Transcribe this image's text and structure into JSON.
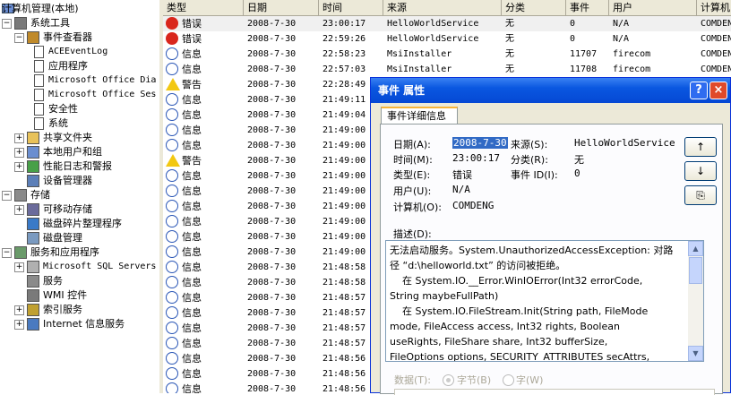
{
  "tree": {
    "root": "计算机管理(本地)",
    "items": [
      {
        "label": "系统工具",
        "level": 0,
        "exp": "−",
        "icon": "tools-icon",
        "mono": false
      },
      {
        "label": "事件查看器",
        "level": 1,
        "exp": "−",
        "icon": "event-viewer-icon",
        "mono": false
      },
      {
        "label": "ACEEventLog",
        "level": 2,
        "exp": "",
        "icon": "log-icon",
        "mono": true
      },
      {
        "label": "应用程序",
        "level": 2,
        "exp": "",
        "icon": "log-icon",
        "mono": false
      },
      {
        "label": "Microsoft Office Dia",
        "level": 2,
        "exp": "",
        "icon": "log-icon",
        "mono": true
      },
      {
        "label": "Microsoft Office Ses",
        "level": 2,
        "exp": "",
        "icon": "log-icon",
        "mono": true
      },
      {
        "label": "安全性",
        "level": 2,
        "exp": "",
        "icon": "log-icon",
        "mono": false
      },
      {
        "label": "系统",
        "level": 2,
        "exp": "",
        "icon": "log-icon",
        "mono": false
      },
      {
        "label": "共享文件夹",
        "level": 1,
        "exp": "+",
        "icon": "folder-icon",
        "mono": false
      },
      {
        "label": "本地用户和组",
        "level": 1,
        "exp": "+",
        "icon": "users-icon",
        "mono": false
      },
      {
        "label": "性能日志和警报",
        "level": 1,
        "exp": "+",
        "icon": "perf-icon",
        "mono": false
      },
      {
        "label": "设备管理器",
        "level": 1,
        "exp": "",
        "icon": "device-icon",
        "mono": false
      },
      {
        "label": "存储",
        "level": 0,
        "exp": "−",
        "icon": "storage-icon",
        "mono": false
      },
      {
        "label": "可移动存储",
        "level": 1,
        "exp": "+",
        "icon": "removable-icon",
        "mono": false
      },
      {
        "label": "磁盘碎片整理程序",
        "level": 1,
        "exp": "",
        "icon": "defrag-icon",
        "mono": false
      },
      {
        "label": "磁盘管理",
        "level": 1,
        "exp": "",
        "icon": "disk-icon",
        "mono": false
      },
      {
        "label": "服务和应用程序",
        "level": 0,
        "exp": "−",
        "icon": "services-apps-icon",
        "mono": false
      },
      {
        "label": "Microsoft SQL Servers",
        "level": 1,
        "exp": "+",
        "icon": "sql-icon",
        "mono": true
      },
      {
        "label": "服务",
        "level": 1,
        "exp": "",
        "icon": "gear-icon",
        "mono": false
      },
      {
        "label": "WMI 控件",
        "level": 1,
        "exp": "",
        "icon": "wmi-icon",
        "mono": false
      },
      {
        "label": "索引服务",
        "level": 1,
        "exp": "+",
        "icon": "index-icon",
        "mono": false
      },
      {
        "label": "Internet 信息服务",
        "level": 1,
        "exp": "+",
        "icon": "iis-icon",
        "mono": false
      }
    ]
  },
  "list": {
    "columns": [
      "类型",
      "日期",
      "时间",
      "来源",
      "分类",
      "事件",
      "用户",
      "计算机"
    ],
    "rows": [
      {
        "type": "错误",
        "sev": "error",
        "date": "2008-7-30",
        "time": "23:00:17",
        "source": "HelloWorldService",
        "cat": "无",
        "event": "0",
        "user": "N/A",
        "computer": "COMDENG"
      },
      {
        "type": "错误",
        "sev": "error",
        "date": "2008-7-30",
        "time": "22:59:26",
        "source": "HelloWorldService",
        "cat": "无",
        "event": "0",
        "user": "N/A",
        "computer": "COMDENG"
      },
      {
        "type": "信息",
        "sev": "info",
        "date": "2008-7-30",
        "time": "22:58:23",
        "source": "MsiInstaller",
        "cat": "无",
        "event": "11707",
        "user": "firecom",
        "computer": "COMDENG"
      },
      {
        "type": "信息",
        "sev": "info",
        "date": "2008-7-30",
        "time": "22:57:03",
        "source": "MsiInstaller",
        "cat": "无",
        "event": "11708",
        "user": "firecom",
        "computer": "COMDENG"
      },
      {
        "type": "警告",
        "sev": "warn",
        "date": "2008-7-30",
        "time": "22:28:49",
        "source": "",
        "cat": "",
        "event": "",
        "user": "",
        "computer": ""
      },
      {
        "type": "信息",
        "sev": "info",
        "date": "2008-7-30",
        "time": "21:49:11",
        "source": "",
        "cat": "",
        "event": "",
        "user": "",
        "computer": ""
      },
      {
        "type": "信息",
        "sev": "info",
        "date": "2008-7-30",
        "time": "21:49:04",
        "source": "",
        "cat": "",
        "event": "",
        "user": "",
        "computer": ""
      },
      {
        "type": "信息",
        "sev": "info",
        "date": "2008-7-30",
        "time": "21:49:00",
        "source": "",
        "cat": "",
        "event": "",
        "user": "",
        "computer": ""
      },
      {
        "type": "信息",
        "sev": "info",
        "date": "2008-7-30",
        "time": "21:49:00",
        "source": "",
        "cat": "",
        "event": "",
        "user": "",
        "computer": ""
      },
      {
        "type": "警告",
        "sev": "warn",
        "date": "2008-7-30",
        "time": "21:49:00",
        "source": "",
        "cat": "",
        "event": "",
        "user": "",
        "computer": ""
      },
      {
        "type": "信息",
        "sev": "info",
        "date": "2008-7-30",
        "time": "21:49:00",
        "source": "",
        "cat": "",
        "event": "",
        "user": "",
        "computer": ""
      },
      {
        "type": "信息",
        "sev": "info",
        "date": "2008-7-30",
        "time": "21:49:00",
        "source": "",
        "cat": "",
        "event": "",
        "user": "",
        "computer": ""
      },
      {
        "type": "信息",
        "sev": "info",
        "date": "2008-7-30",
        "time": "21:49:00",
        "source": "",
        "cat": "",
        "event": "",
        "user": "",
        "computer": ""
      },
      {
        "type": "信息",
        "sev": "info",
        "date": "2008-7-30",
        "time": "21:49:00",
        "source": "",
        "cat": "",
        "event": "",
        "user": "",
        "computer": ""
      },
      {
        "type": "信息",
        "sev": "info",
        "date": "2008-7-30",
        "time": "21:49:00",
        "source": "",
        "cat": "",
        "event": "",
        "user": "",
        "computer": ""
      },
      {
        "type": "信息",
        "sev": "info",
        "date": "2008-7-30",
        "time": "21:49:00",
        "source": "",
        "cat": "",
        "event": "",
        "user": "",
        "computer": ""
      },
      {
        "type": "信息",
        "sev": "info",
        "date": "2008-7-30",
        "time": "21:48:58",
        "source": "",
        "cat": "",
        "event": "",
        "user": "",
        "computer": ""
      },
      {
        "type": "信息",
        "sev": "info",
        "date": "2008-7-30",
        "time": "21:48:58",
        "source": "",
        "cat": "",
        "event": "",
        "user": "",
        "computer": ""
      },
      {
        "type": "信息",
        "sev": "info",
        "date": "2008-7-30",
        "time": "21:48:57",
        "source": "",
        "cat": "",
        "event": "",
        "user": "",
        "computer": ""
      },
      {
        "type": "信息",
        "sev": "info",
        "date": "2008-7-30",
        "time": "21:48:57",
        "source": "",
        "cat": "",
        "event": "",
        "user": "",
        "computer": ""
      },
      {
        "type": "信息",
        "sev": "info",
        "date": "2008-7-30",
        "time": "21:48:57",
        "source": "",
        "cat": "",
        "event": "",
        "user": "",
        "computer": ""
      },
      {
        "type": "信息",
        "sev": "info",
        "date": "2008-7-30",
        "time": "21:48:57",
        "source": "",
        "cat": "",
        "event": "",
        "user": "",
        "computer": ""
      },
      {
        "type": "信息",
        "sev": "info",
        "date": "2008-7-30",
        "time": "21:48:56",
        "source": "",
        "cat": "",
        "event": "",
        "user": "",
        "computer": ""
      },
      {
        "type": "信息",
        "sev": "info",
        "date": "2008-7-30",
        "time": "21:48:56",
        "source": "",
        "cat": "",
        "event": "",
        "user": "",
        "computer": ""
      },
      {
        "type": "信息",
        "sev": "info",
        "date": "2008-7-30",
        "time": "21:48:56",
        "source": "",
        "cat": "",
        "event": "",
        "user": "",
        "computer": ""
      },
      {
        "type": "信息",
        "sev": "info",
        "date": "2008-7-30",
        "time": "21:48:56",
        "source": "",
        "cat": "",
        "event": "",
        "user": "",
        "computer": ""
      }
    ]
  },
  "dialog": {
    "title": "事件 属性",
    "help_label": "?",
    "close_label": "×",
    "tab_label": "事件详细信息",
    "date_label": "日期(A):",
    "date_value": "2008-7-30",
    "source_label": "来源(S):",
    "source_value": "HelloWorldService",
    "time_label": "时间(M):",
    "time_value": "23:00:17",
    "category_label": "分类(R):",
    "category_value": "无",
    "type_label": "类型(E):",
    "type_value": "错误",
    "eventid_label": "事件 ID(I):",
    "eventid_value": "0",
    "user_label": "用户(U):",
    "user_value": "N/A",
    "computer_label": "计算机(O):",
    "computer_value": "COMDENG",
    "up_label": "↑",
    "down_label": "↓",
    "copy_label": "⎘",
    "desc_label": "描述(D):",
    "desc_lines": [
      "无法启动服务。System.UnauthorizedAccessException: 对路",
      "径 “d:\\helloworld.txt” 的访问被拒绝。",
      "    在 System.IO.__Error.WinIOError(Int32 errorCode,",
      "String maybeFullPath)",
      "    在 System.IO.FileStream.Init(String path, FileMode",
      "mode, FileAccess access, Int32 rights, Boolean",
      "useRights, FileShare share, Int32 bufferSize,",
      "FileOptions options, SECURITY_ATTRIBUTES secAttrs,"
    ],
    "data_label": "数据(T):",
    "bytes_label": "字节(B)",
    "words_label": "字(W)"
  }
}
